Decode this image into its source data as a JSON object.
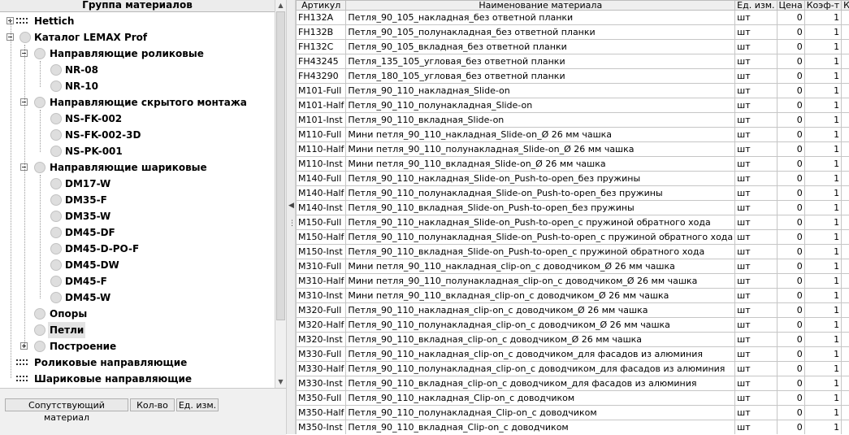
{
  "tree": {
    "header": "Группа материалов",
    "nodes": [
      {
        "label": "Hettich",
        "level": 0,
        "kind": "group",
        "expander": "plus"
      },
      {
        "label": "Каталог LEMAX Prof",
        "level": 0,
        "kind": "catalog",
        "expander": "minus"
      },
      {
        "label": "Направляющие роликовые",
        "level": 1,
        "kind": "folder",
        "expander": "minus"
      },
      {
        "label": "NR-08",
        "level": 2,
        "kind": "leaf"
      },
      {
        "label": "NR-10",
        "level": 2,
        "kind": "leaf"
      },
      {
        "label": "Направляющие скрытого монтажа",
        "level": 1,
        "kind": "folder",
        "expander": "minus"
      },
      {
        "label": "NS-FK-002",
        "level": 2,
        "kind": "leaf"
      },
      {
        "label": "NS-FK-002-3D",
        "level": 2,
        "kind": "leaf"
      },
      {
        "label": "NS-PK-001",
        "level": 2,
        "kind": "leaf"
      },
      {
        "label": "Направляющие шариковые",
        "level": 1,
        "kind": "folder",
        "expander": "minus"
      },
      {
        "label": "DM17-W",
        "level": 2,
        "kind": "leaf"
      },
      {
        "label": "DM35-F",
        "level": 2,
        "kind": "leaf"
      },
      {
        "label": "DM35-W",
        "level": 2,
        "kind": "leaf"
      },
      {
        "label": "DM45-DF",
        "level": 2,
        "kind": "leaf"
      },
      {
        "label": "DM45-D-PO-F",
        "level": 2,
        "kind": "leaf"
      },
      {
        "label": "DM45-DW",
        "level": 2,
        "kind": "leaf"
      },
      {
        "label": "DM45-F",
        "level": 2,
        "kind": "leaf"
      },
      {
        "label": "DM45-W",
        "level": 2,
        "kind": "leaf"
      },
      {
        "label": "Опоры",
        "level": 1,
        "kind": "folder"
      },
      {
        "label": "Петли",
        "level": 1,
        "kind": "folder",
        "selected": true
      },
      {
        "label": "Построение",
        "level": 1,
        "kind": "folder",
        "expander": "plus"
      },
      {
        "label": "Роликовые направляющие",
        "level": 0,
        "kind": "group"
      },
      {
        "label": "Шариковые направляющие",
        "level": 0,
        "kind": "group"
      }
    ]
  },
  "bottom_tabs": [
    "Сопутствующий материал",
    "Кол-во",
    "Ед. изм."
  ],
  "grid": {
    "columns": [
      "Артикул",
      "Наименование материала",
      "Ед. изм.",
      "Цена",
      "Коэф-т",
      "Класс"
    ],
    "rows": [
      [
        "FH132A",
        "Петля_90_105_накладная_без ответной планки",
        "шт",
        "0",
        "1",
        ""
      ],
      [
        "FH132B",
        "Петля_90_105_полунакладная_без ответной планки",
        "шт",
        "0",
        "1",
        ""
      ],
      [
        "FH132C",
        "Петля_90_105_вкладная_без ответной планки",
        "шт",
        "0",
        "1",
        ""
      ],
      [
        "FH43245",
        "Петля_135_105_угловая_без ответной планки",
        "шт",
        "0",
        "1",
        ""
      ],
      [
        "FH43290",
        "Петля_180_105_угловая_без ответной планки",
        "шт",
        "0",
        "1",
        ""
      ],
      [
        "M101-Full",
        "Петля_90_110_накладная_Slide-on",
        "шт",
        "0",
        "1",
        ""
      ],
      [
        "M101-Half",
        "Петля_90_110_полунакладная_Slide-on",
        "шт",
        "0",
        "1",
        ""
      ],
      [
        "M101-Inst",
        "Петля_90_110_вкладная_Slide-on",
        "шт",
        "0",
        "1",
        ""
      ],
      [
        "M110-Full",
        "Мини петля_90_110_накладная_Slide-on_Ø 26 мм чашка",
        "шт",
        "0",
        "1",
        ""
      ],
      [
        "M110-Half",
        "Мини петля_90_110_полунакладная_Slide-on_Ø 26 мм чашка",
        "шт",
        "0",
        "1",
        ""
      ],
      [
        "M110-Inst",
        "Мини петля_90_110_вкладная_Slide-on_Ø 26 мм чашка",
        "шт",
        "0",
        "1",
        ""
      ],
      [
        "M140-Full",
        "Петля_90_110_накладная_Slide-on_Push-to-open_без пружины",
        "шт",
        "0",
        "1",
        ""
      ],
      [
        "M140-Half",
        "Петля_90_110_полунакладная_Slide-on_Push-to-open_без пружины",
        "шт",
        "0",
        "1",
        ""
      ],
      [
        "M140-Inst",
        "Петля_90_110_вкладная_Slide-on_Push-to-open_без пружины",
        "шт",
        "0",
        "1",
        ""
      ],
      [
        "M150-Full",
        "Петля_90_110_накладная_Slide-on_Push-to-open_с пружиной обратного хода",
        "шт",
        "0",
        "1",
        ""
      ],
      [
        "M150-Half",
        "Петля_90_110_полунакладная_Slide-on_Push-to-open_с пружиной обратного хода",
        "шт",
        "0",
        "1",
        ""
      ],
      [
        "M150-Inst",
        "Петля_90_110_вкладная_Slide-on_Push-to-open_с пружиной обратного хода",
        "шт",
        "0",
        "1",
        ""
      ],
      [
        "M310-Full",
        "Мини петля_90_110_накладная_clip-on_с доводчиком_Ø 26 мм чашка",
        "шт",
        "0",
        "1",
        ""
      ],
      [
        "M310-Half",
        "Мини петля_90_110_полунакладная_clip-on_с доводчиком_Ø 26 мм чашка",
        "шт",
        "0",
        "1",
        ""
      ],
      [
        "M310-Inst",
        "Мини петля_90_110_вкладная_clip-on_с доводчиком_Ø 26 мм чашка",
        "шт",
        "0",
        "1",
        ""
      ],
      [
        "M320-Full",
        "Петля_90_110_накладная_clip-on_с доводчиком_Ø 26 мм чашка",
        "шт",
        "0",
        "1",
        ""
      ],
      [
        "M320-Half",
        "Петля_90_110_полунакладная_clip-on_с доводчиком_Ø 26 мм чашка",
        "шт",
        "0",
        "1",
        ""
      ],
      [
        "M320-Inst",
        "Петля_90_110_вкладная_clip-on_с доводчиком_Ø 26 мм чашка",
        "шт",
        "0",
        "1",
        ""
      ],
      [
        "M330-Full",
        "Петля_90_110_накладная_clip-on_с доводчиком_для фасадов из алюминия",
        "шт",
        "0",
        "1",
        ""
      ],
      [
        "M330-Half",
        "Петля_90_110_полунакладная_clip-on_с доводчиком_для фасадов из алюминия",
        "шт",
        "0",
        "1",
        ""
      ],
      [
        "M330-Inst",
        "Петля_90_110_вкладная_clip-on_с доводчиком_для фасадов из алюминия",
        "шт",
        "0",
        "1",
        ""
      ],
      [
        "M350-Full",
        "Петля_90_110_накладная_Clip-on_с доводчиком",
        "шт",
        "0",
        "1",
        ""
      ],
      [
        "M350-Half",
        "Петля_90_110_полунакладная_Clip-on_с доводчиком",
        "шт",
        "0",
        "1",
        ""
      ],
      [
        "M350-Inst",
        "Петля_90_110_вкладная_Clip-on_с доводчиком",
        "шт",
        "0",
        "1",
        ""
      ]
    ]
  },
  "colors": {
    "selected_row_bg": "#e3e3e3",
    "header_bg": "#efefef",
    "panel_bg": "#f0f0f0"
  }
}
